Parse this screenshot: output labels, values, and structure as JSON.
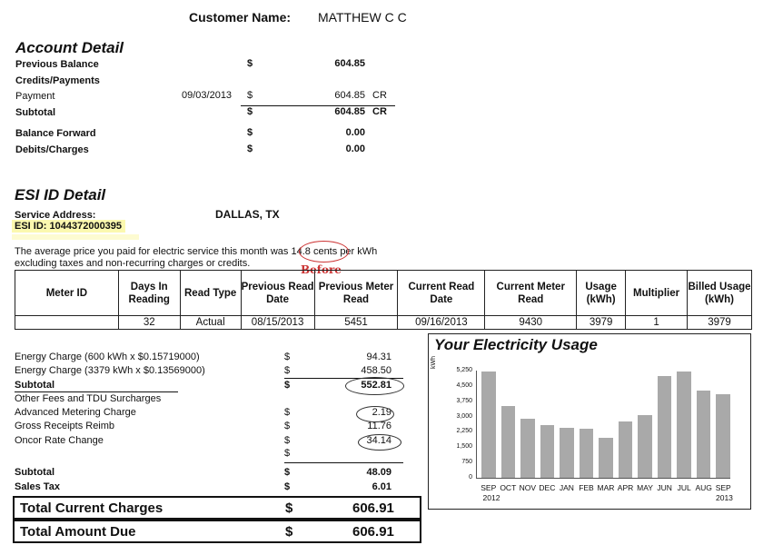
{
  "customer": {
    "label": "Customer Name:",
    "name": "MATTHEW C C"
  },
  "account_detail": {
    "title": "Account Detail",
    "rows": [
      {
        "label": "Previous Balance",
        "date": "",
        "currency": "$",
        "amount": "604.85",
        "suffix": ""
      },
      {
        "label": "Credits/Payments",
        "date": "",
        "currency": "",
        "amount": "",
        "suffix": ""
      },
      {
        "label": "Payment",
        "date": "09/03/2013",
        "currency": "$",
        "amount": "604.85",
        "suffix": "CR"
      },
      {
        "label": "Subtotal",
        "date": "",
        "currency": "$",
        "amount": "604.85",
        "suffix": "CR"
      },
      {
        "label": "Balance Forward",
        "date": "",
        "currency": "$",
        "amount": "0.00",
        "suffix": ""
      },
      {
        "label": "Debits/Charges",
        "date": "",
        "currency": "$",
        "amount": "0.00",
        "suffix": ""
      }
    ]
  },
  "esi": {
    "title": "ESI ID Detail",
    "service_address_label": "Service Address:",
    "service_address": "DALLAS, TX",
    "esi_id": "ESI ID: 1044372000395",
    "avg_text_before": "The average price you paid for electric service this month was",
    "avg_price": "14.8 cents",
    "avg_text_after": "per kWh",
    "avg_line2": "excluding taxes and non-recurring charges or credits.",
    "annotation": "Before"
  },
  "meter_table": {
    "headers": [
      "Meter ID",
      "Days In Reading",
      "Read Type",
      "Previous Read Date",
      "Previous Meter Read",
      "Current Read Date",
      "Current Meter Read",
      "Usage (kWh)",
      "Multiplier",
      "Billed Usage (kWh)"
    ],
    "row": [
      "",
      "32",
      "Actual",
      "08/15/2013",
      "5451",
      "09/16/2013",
      "9430",
      "3979",
      "1",
      "3979"
    ]
  },
  "charges": [
    {
      "label": "Energy Charge (600 kWh x $0.15719000)",
      "currency": "$",
      "amount": "94.31"
    },
    {
      "label": "Energy Charge (3379 kWh x $0.13569000)",
      "currency": "$",
      "amount": "458.50"
    },
    {
      "label": "Subtotal",
      "currency": "$",
      "amount": "552.81"
    },
    {
      "label": "Other Fees and TDU Surcharges",
      "currency": "",
      "amount": ""
    },
    {
      "label": "Advanced Metering Charge",
      "currency": "$",
      "amount": "2.19"
    },
    {
      "label": "Gross Receipts Reimb",
      "currency": "$",
      "amount": "11.76"
    },
    {
      "label": "Oncor Rate Change",
      "currency": "$",
      "amount": "34.14"
    },
    {
      "label": "",
      "currency": "$",
      "amount": ""
    },
    {
      "label": "Subtotal",
      "currency": "$",
      "amount": "48.09"
    },
    {
      "label": "Sales Tax",
      "currency": "$",
      "amount": "6.01"
    }
  ],
  "totals": {
    "current_label": "Total Current Charges",
    "current_currency": "$",
    "current_amount": "606.91",
    "due_label": "Total Amount Due",
    "due_currency": "$",
    "due_amount": "606.91"
  },
  "chart_data": {
    "type": "bar",
    "title": "Your Electricity Usage",
    "ylabel": "kWh",
    "categories": [
      "SEP",
      "OCT",
      "NOV",
      "DEC",
      "JAN",
      "FEB",
      "MAR",
      "APR",
      "MAY",
      "JUN",
      "JUL",
      "AUG",
      "SEP"
    ],
    "year_labels": [
      "2012",
      "2013"
    ],
    "values": [
      5200,
      3500,
      2900,
      2600,
      2450,
      2400,
      1950,
      2750,
      3050,
      5000,
      5200,
      4250,
      4100
    ],
    "yticks": [
      "5,250",
      "4,500",
      "3,750",
      "3,000",
      "2,250",
      "1,500",
      "750",
      "0"
    ],
    "ylim": [
      0,
      5250
    ],
    "bar_color": "#a9a9a9"
  }
}
